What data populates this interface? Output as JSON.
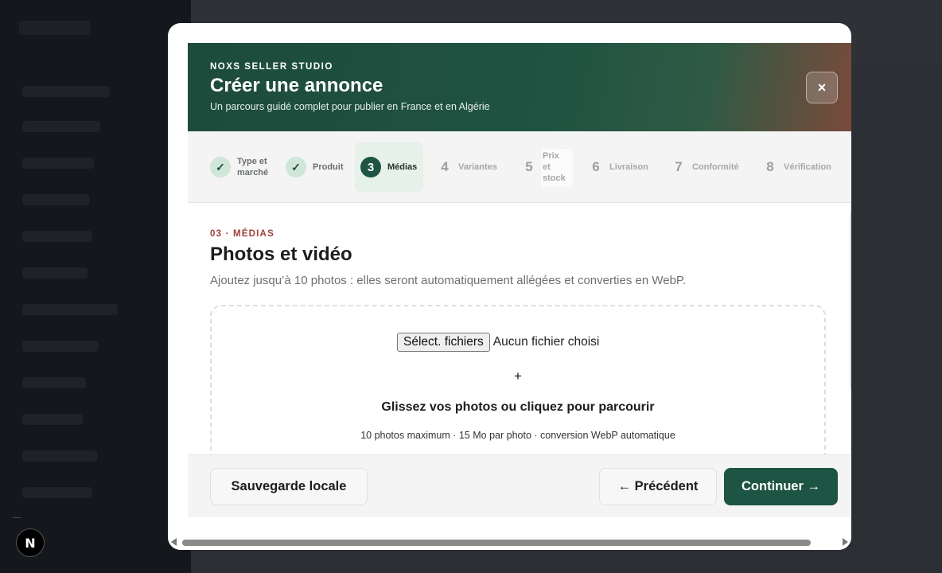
{
  "modal": {
    "eyebrow": "NOXS SELLER STUDIO",
    "title": "Créer une annonce",
    "subtitle": "Un parcours guidé complet pour publier en France et en Algérie",
    "close_label": "×"
  },
  "stepper": {
    "steps": [
      {
        "marker": "✓",
        "label_line1": "Type et",
        "label_line2": "marché",
        "state": "done"
      },
      {
        "marker": "✓",
        "label_line1": "Produit",
        "label_line2": "",
        "state": "done"
      },
      {
        "marker": "3",
        "label_line1": "Médias",
        "label_line2": "",
        "state": "active"
      },
      {
        "marker": "4",
        "label_line1": "Variantes",
        "label_line2": "",
        "state": "todo"
      },
      {
        "marker": "5",
        "label_line1": "Prix",
        "label_line2": "et",
        "label_line3": "stock",
        "state": "todo"
      },
      {
        "marker": "6",
        "label_line1": "Livraison",
        "label_line2": "",
        "state": "todo"
      },
      {
        "marker": "7",
        "label_line1": "Conformité",
        "label_line2": "",
        "state": "todo"
      },
      {
        "marker": "8",
        "label_line1": "Vérification",
        "label_line2": "",
        "state": "todo"
      }
    ]
  },
  "section": {
    "kicker": "03 · MÉDIAS",
    "title": "Photos et vidéo",
    "lead": "Ajoutez jusqu’à 10 photos : elles seront automatiquement allégées et converties en WebP."
  },
  "dropzone": {
    "file_button": "Sélect. fichiers",
    "file_status": "Aucun fichier choisi",
    "plus": "+",
    "title": "Glissez vos photos ou cliquez pour parcourir",
    "hint": "10 photos maximum · 15 Mo par photo · conversion WebP automatique"
  },
  "footer": {
    "save_label": "Sauvegarde locale",
    "prev_label": "← Précédent",
    "next_label": "Continuer →"
  },
  "dev_badge": "N",
  "colors": {
    "accent": "#1d5443",
    "kicker": "#a0403a",
    "backdrop": "#2b2e33"
  }
}
